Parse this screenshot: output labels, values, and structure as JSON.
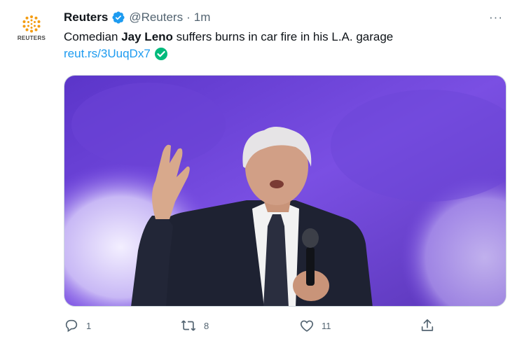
{
  "tweet": {
    "author_name": "Reuters",
    "handle": "@Reuters",
    "separator": "·",
    "time": "1m",
    "more_label": "···",
    "text_before": "Comedian ",
    "text_bold": "Jay Leno",
    "text_after": " suffers burns in car fire in his L.A. garage",
    "link_text": "reut.rs/3UuqDx7"
  },
  "avatar": {
    "label": "REUTERS",
    "color": "#f39c12"
  },
  "colors": {
    "verified": "#1d9bf0",
    "link": "#1d9bf0",
    "check_badge": "#00ba7c",
    "muted": "#536471"
  },
  "actions": {
    "replies": "1",
    "retweets": "8",
    "likes": "11"
  }
}
